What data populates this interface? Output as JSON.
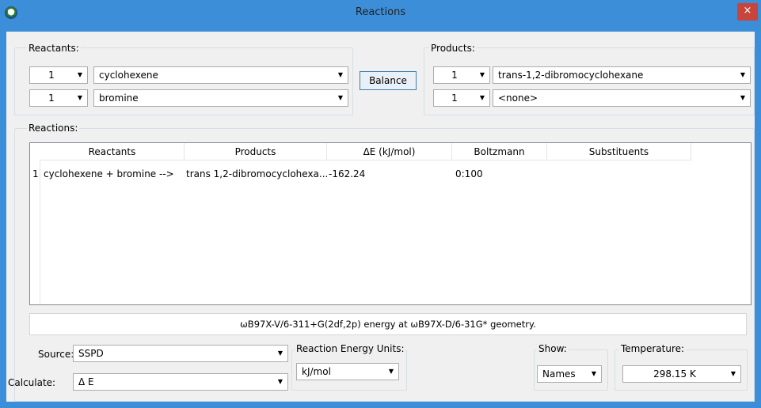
{
  "window": {
    "title": "Reactions",
    "close_glyph": "×",
    "app_icon": "app-logo-icon"
  },
  "reactants": {
    "label": "Reactants:",
    "rows": [
      {
        "count": "1",
        "species": "cyclohexene"
      },
      {
        "count": "1",
        "species": "bromine"
      }
    ]
  },
  "products": {
    "label": "Products:",
    "rows": [
      {
        "count": "1",
        "species": "trans-1,2-dibromocyclohexane"
      },
      {
        "count": "1",
        "species": "<none>"
      }
    ]
  },
  "balance_label": "Balance",
  "reactions": {
    "label": "Reactions:",
    "columns": [
      "Reactants",
      "Products",
      "ΔE (kJ/mol)",
      "Boltzmann",
      "Substituents"
    ],
    "rows": [
      {
        "index": "1",
        "reactants": "cyclohexene + bromine -->",
        "products": "trans 1,2-dibromocyclohexa...",
        "delta_e": "-162.24",
        "boltzmann": "0:100",
        "substituents": ""
      }
    ]
  },
  "method_note": "ωB97X-V/6-311+G(2df,2p) energy at ωB97X-D/6-31G* geometry.",
  "source": {
    "label": "Source:",
    "value": "SSPD"
  },
  "calculate": {
    "label": "Calculate:",
    "value": "Δ E"
  },
  "energy_units": {
    "label": "Reaction Energy Units:",
    "value": "kJ/mol"
  },
  "show": {
    "label": "Show:",
    "value": "Names"
  },
  "temperature": {
    "label": "Temperature:",
    "value": "298.15 K"
  },
  "colors": {
    "titlebar": "#3d8ed8",
    "close": "#c7453a",
    "panel": "#f0f0f0",
    "button_border": "#3c7fb1"
  }
}
